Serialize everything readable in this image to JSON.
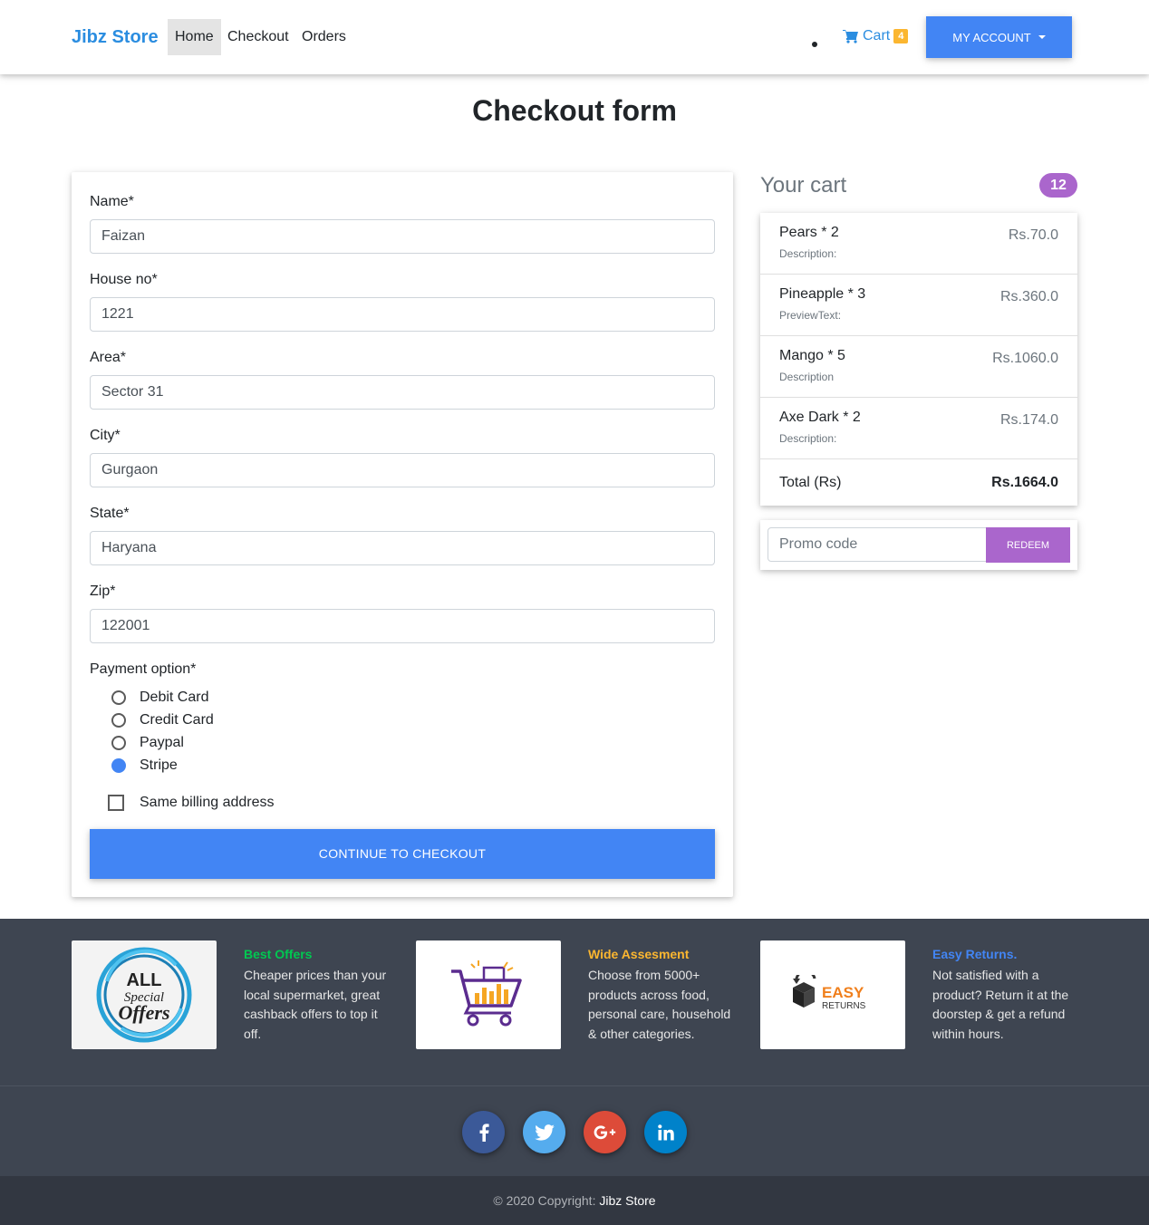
{
  "navbar": {
    "brand": "Jibz Store",
    "links": [
      "Home",
      "Checkout",
      "Orders"
    ],
    "cart_label": "Cart",
    "cart_count": "4",
    "account_label": "MY ACCOUNT"
  },
  "page": {
    "title": "Checkout form"
  },
  "form": {
    "fields": [
      {
        "label": "Name*",
        "value": "Faizan"
      },
      {
        "label": "House no*",
        "value": "1221"
      },
      {
        "label": "Area*",
        "value": "Sector 31"
      },
      {
        "label": "City*",
        "value": "Gurgaon"
      },
      {
        "label": "State*",
        "value": "Haryana"
      },
      {
        "label": "Zip*",
        "value": "122001"
      }
    ],
    "payment_label": "Payment option*",
    "payment_options": [
      "Debit Card",
      "Credit Card",
      "Paypal",
      "Stripe"
    ],
    "payment_selected": "Stripe",
    "same_billing_label": "Same billing address",
    "submit_label": "CONTINUE TO CHECKOUT"
  },
  "cart": {
    "title": "Your cart",
    "count": "12",
    "items": [
      {
        "name": "Pears * 2",
        "desc": "Description:",
        "price": "Rs.70.0"
      },
      {
        "name": "Pineapple * 3",
        "desc": "PreviewText:",
        "price": "Rs.360.0"
      },
      {
        "name": "Mango * 5",
        "desc": "Description",
        "price": "Rs.1060.0"
      },
      {
        "name": "Axe Dark * 2",
        "desc": "Description:",
        "price": "Rs.174.0"
      }
    ],
    "total_label": "Total (Rs)",
    "total_value": "Rs.1664.0",
    "promo_placeholder": "Promo code",
    "redeem_label": "REDEEM"
  },
  "footer": {
    "features": [
      {
        "title": "Best Offers",
        "text": "Cheaper prices than your local supermarket, great cashback offers to top it off.",
        "color": "#00c851",
        "image_text_1": "ALL",
        "image_text_2": "Special",
        "image_text_3": "Offers"
      },
      {
        "title": "Wide Assesment",
        "text": "Choose from 5000+ products across food, personal care, household & other categories.",
        "color": "#fbb630"
      },
      {
        "title": "Easy Returns.",
        "text": "Not satisfied with a product? Return it at the doorstep & get a refund within hours.",
        "color": "#4285f4",
        "image_text_1": "EASY",
        "image_text_2": "RETURNS"
      }
    ],
    "social": [
      "facebook-icon",
      "twitter-icon",
      "google-plus-icon",
      "linkedin-icon"
    ],
    "copyright": "© 2020 Copyright:",
    "copyright_link": "Jibz Store"
  },
  "colors": {
    "primary": "#4285f4",
    "secondary": "#aa66cc",
    "brand": "#2b8de0",
    "footer": "#3e4551",
    "facebook": "#3b5998",
    "twitter": "#55acee",
    "google": "#dd4b39",
    "linkedin": "#0082ca"
  }
}
